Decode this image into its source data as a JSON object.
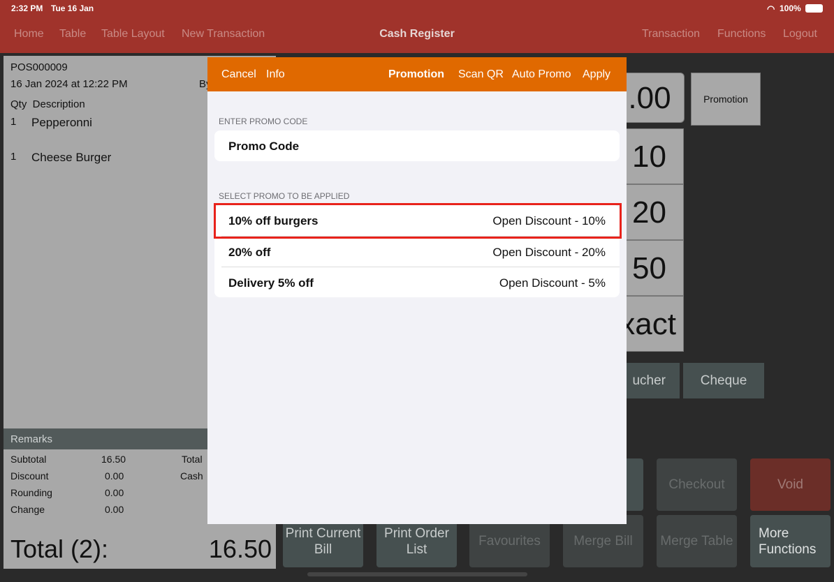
{
  "status_bar": {
    "time": "2:32 PM",
    "date": "Tue 16 Jan",
    "battery": "100%",
    "wifi_icon": "wifi-icon",
    "battery_icon": "battery-icon"
  },
  "nav": {
    "left": [
      "Home",
      "Table",
      "Table Layout",
      "New Transaction"
    ],
    "title": "Cash Register",
    "right": [
      "Transaction",
      "Functions",
      "Logout"
    ]
  },
  "receipt": {
    "id": "POS000009",
    "datetime": "16 Jan 2024 at 12:22 PM",
    "by": "By",
    "header": "Qty  Description",
    "items": [
      {
        "qty": "1",
        "desc": "Pepperonni"
      },
      {
        "qty": "1",
        "desc": "Cheese Burger"
      }
    ],
    "remarks": "Remarks",
    "summary": [
      {
        "label": "Subtotal",
        "value": "16.50"
      },
      {
        "label": "Discount",
        "value": "0.00"
      },
      {
        "label": "Rounding",
        "value": "0.00"
      },
      {
        "label": "Change",
        "value": "0.00"
      }
    ],
    "summary_right": [
      "Total",
      "Cash"
    ],
    "total_label": "Total (2):",
    "total_value": "16.50"
  },
  "keypad": {
    "amount": ".00",
    "promotion": "Promotion",
    "keys": [
      "10",
      "20",
      "50",
      "xact"
    ],
    "voucher": "ucher",
    "cheque": "Cheque"
  },
  "actions": {
    "checkout": "Checkout",
    "void": "Void",
    "print_bill": "Print Current Bill",
    "print_order": "Print Order List",
    "favourites": "Favourites",
    "merge_bill": "Merge Bill",
    "merge_table": "Merge Table",
    "more": "More Functions"
  },
  "modal": {
    "cancel": "Cancel",
    "info": "Info",
    "promotion": "Promotion",
    "scan_qr": "Scan QR",
    "auto_promo": "Auto Promo",
    "apply": "Apply",
    "enter_label": "ENTER PROMO CODE",
    "promo_placeholder": "Promo Code",
    "select_label": "SELECT PROMO TO BE APPLIED",
    "promos": [
      {
        "name": "10% off burgers",
        "type": "Open Discount - 10%",
        "highlighted": true
      },
      {
        "name": "20% off",
        "type": "Open Discount - 20%"
      },
      {
        "name": "Delivery 5% off",
        "type": "Open Discount - 5%"
      }
    ],
    "highlight_color": "#e8221b",
    "header_color": "#e06900"
  }
}
